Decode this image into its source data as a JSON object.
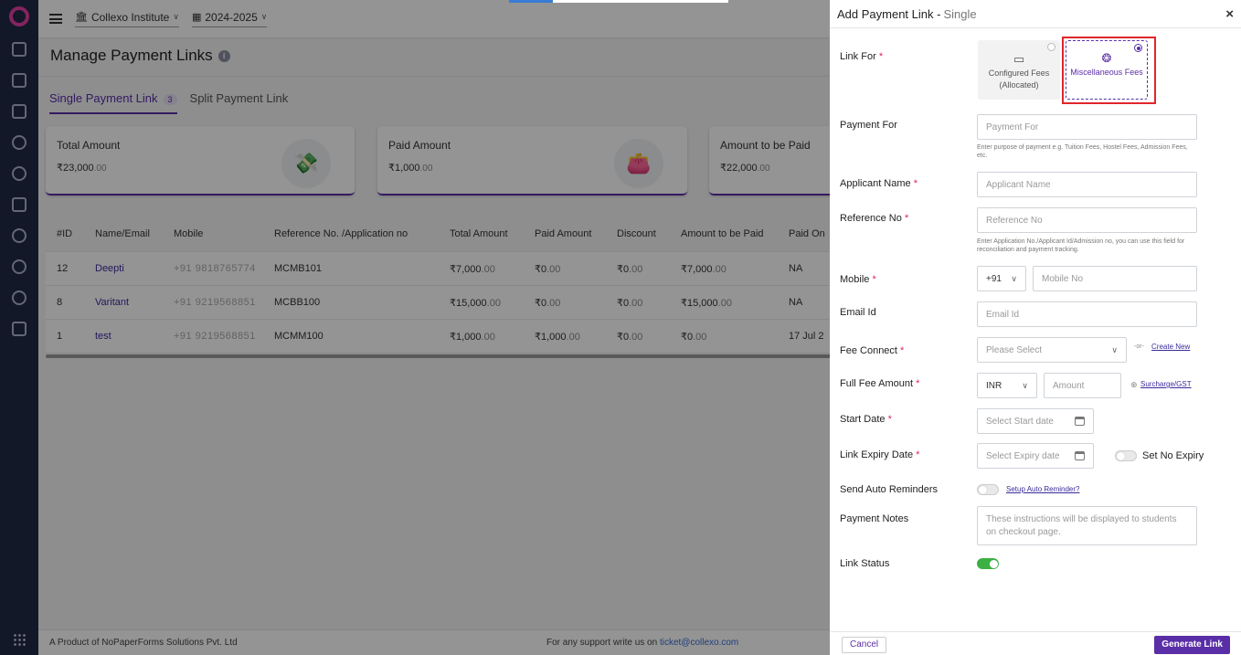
{
  "topbar": {
    "institute": "Collexo Institute",
    "session": "2024-2025"
  },
  "page": {
    "title": "Manage Payment Links",
    "tabs": [
      {
        "label": "Single Payment Link",
        "count": "3"
      },
      {
        "label": "Split Payment Link"
      }
    ]
  },
  "cards": [
    {
      "label": "Total Amount",
      "value": "₹23,000",
      "decimals": ".00",
      "icon": "cash-icon"
    },
    {
      "label": "Paid Amount",
      "value": "₹1,000",
      "decimals": ".00",
      "icon": "wallet-icon"
    },
    {
      "label": "Amount to be Paid",
      "value": "₹22,000",
      "decimals": ".00"
    }
  ],
  "table": {
    "headers": [
      "#ID",
      "Name/Email",
      "Mobile",
      "Reference No. /Application no",
      "Total Amount",
      "Paid Amount",
      "Discount",
      "Amount to be Paid",
      "Paid On"
    ],
    "rows": [
      {
        "id": "12",
        "name": "Deepti",
        "mobile": "+91 9818765774",
        "ref": "MCMB101",
        "total": "₹7,000",
        "total_dec": ".00",
        "paid": "₹0",
        "paid_dec": ".00",
        "discount": "₹0",
        "discount_dec": ".00",
        "due": "₹7,000",
        "due_dec": ".00",
        "paid_on": "NA"
      },
      {
        "id": "8",
        "name": "Varitant",
        "mobile": "+91 9219568851",
        "ref": "MCBB100",
        "total": "₹15,000",
        "total_dec": ".00",
        "paid": "₹0",
        "paid_dec": ".00",
        "discount": "₹0",
        "discount_dec": ".00",
        "due": "₹15,000",
        "due_dec": ".00",
        "paid_on": "NA"
      },
      {
        "id": "1",
        "name": "test",
        "mobile": "+91 9219568851",
        "ref": "MCMM100",
        "total": "₹1,000",
        "total_dec": ".00",
        "paid": "₹1,000",
        "paid_dec": ".00",
        "discount": "₹0",
        "discount_dec": ".00",
        "due": "₹0",
        "due_dec": ".00",
        "paid_on": "17 Jul 2"
      }
    ]
  },
  "footer": {
    "product": "A Product of ",
    "company": "NoPaperForms Solutions Pvt. Ltd",
    "support": "For any support write us on ",
    "email": "ticket@collexo.com"
  },
  "drawer": {
    "title": "Add Payment Link - ",
    "subtitle": "Single",
    "close": "×",
    "link_for": {
      "label": "Link For",
      "options": [
        {
          "label": "Configured Fees (Allocated)",
          "selected": false,
          "icon": "card-icon"
        },
        {
          "label": "Miscellaneous Fees",
          "selected": true,
          "icon": "coins-icon"
        }
      ]
    },
    "payment_for": {
      "label": "Payment For",
      "placeholder": "Payment For",
      "hint": "Enter purpose of payment e.g. Tuition Fees, Hostel Fees, Admission Fees, etc."
    },
    "applicant_name": {
      "label": "Applicant Name",
      "placeholder": "Applicant Name"
    },
    "reference_no": {
      "label": "Reference No",
      "placeholder": "Reference No",
      "hint": "Enter Application No./Applicant Id/Admission no, you can use this field for reconciliation and payment tracking."
    },
    "mobile": {
      "label": "Mobile",
      "code": "+91",
      "placeholder": "Mobile No"
    },
    "email": {
      "label": "Email Id",
      "placeholder": "Email Id"
    },
    "fee_connect": {
      "label": "Fee Connect",
      "placeholder": "Please Select",
      "or": "-or-",
      "link": "Create New"
    },
    "full_fee": {
      "label": "Full Fee Amount",
      "currency": "INR",
      "placeholder": "Amount",
      "link": "Surcharge/GST"
    },
    "start_date": {
      "label": "Start Date",
      "placeholder": "Select Start date"
    },
    "expiry_date": {
      "label": "Link Expiry Date",
      "placeholder": "Select Expiry date",
      "no_expiry": "Set No Expiry"
    },
    "reminders": {
      "label": "Send Auto Reminders",
      "link": "Setup Auto Reminder?"
    },
    "notes": {
      "label": "Payment Notes",
      "placeholder": "These instructions will be displayed to students on checkout page."
    },
    "status": {
      "label": "Link Status",
      "on": true
    },
    "cancel": "Cancel",
    "generate": "Generate Link"
  },
  "colors": {
    "accent": "#5a2ea6",
    "rail": "#1f2a44",
    "highlight": "#e0262c",
    "toggle_on": "#3cb043"
  }
}
